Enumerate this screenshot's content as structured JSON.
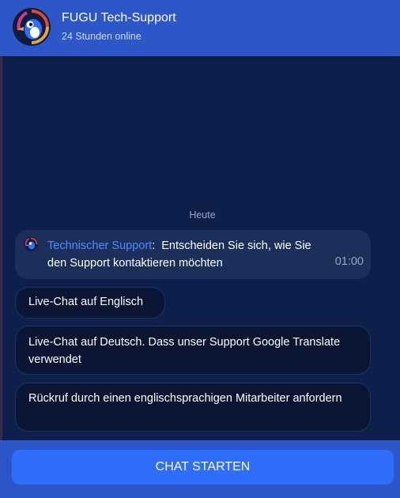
{
  "header": {
    "title": "FUGU Tech-Support",
    "status": "24 Stunden online",
    "avatar_icon": "fugu-bird-icon"
  },
  "chat": {
    "date_label": "Heute",
    "message": {
      "sender": "Technischer Support",
      "separator": ":",
      "text": "Entscheiden Sie sich, wie Sie den Support kontaktieren möchten",
      "time": "01:00",
      "icon": "fugu-bird-icon"
    },
    "options": [
      {
        "label": "Live-Chat auf Englisch"
      },
      {
        "label": "Live-Chat auf Deutsch. Dass unser Support Google Translate verwendet"
      },
      {
        "label": "Rückruf durch einen englischsprachigen Mitarbeiter anfordern"
      }
    ]
  },
  "footer": {
    "start_label": "CHAT STARTEN"
  },
  "colors": {
    "header_bg": "#2d56c8",
    "chat_bg": "#0d1f4a",
    "sender_link": "#4f8cff",
    "button_bg": "#2f6dfb"
  }
}
